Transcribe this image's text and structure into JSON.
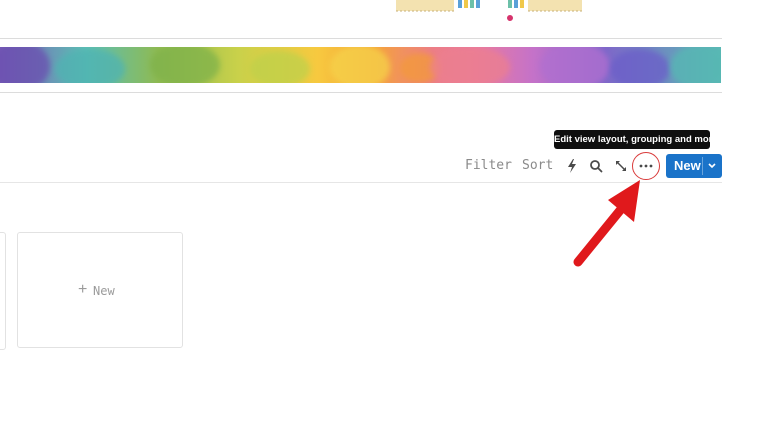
{
  "toolbar": {
    "filter_label": "Filter",
    "sort_label": "Sort",
    "new_label": "New",
    "tooltip_text": "Edit view layout, grouping and more..."
  },
  "board": {
    "new_card_label": "New"
  },
  "icons": {
    "automation": "lightning-icon",
    "search": "search-icon",
    "expand": "expand-arrows-icon",
    "more": "more-dots-icon",
    "new_dropdown": "chevron-down-icon",
    "new_card": "plus-icon",
    "callout": "red-arrow-annotation"
  },
  "colors": {
    "accent": "#1a73c9",
    "tooltip_bg": "#0f0f0f",
    "annotation": "#e0191c",
    "muted_text": "#8a8a8a"
  }
}
